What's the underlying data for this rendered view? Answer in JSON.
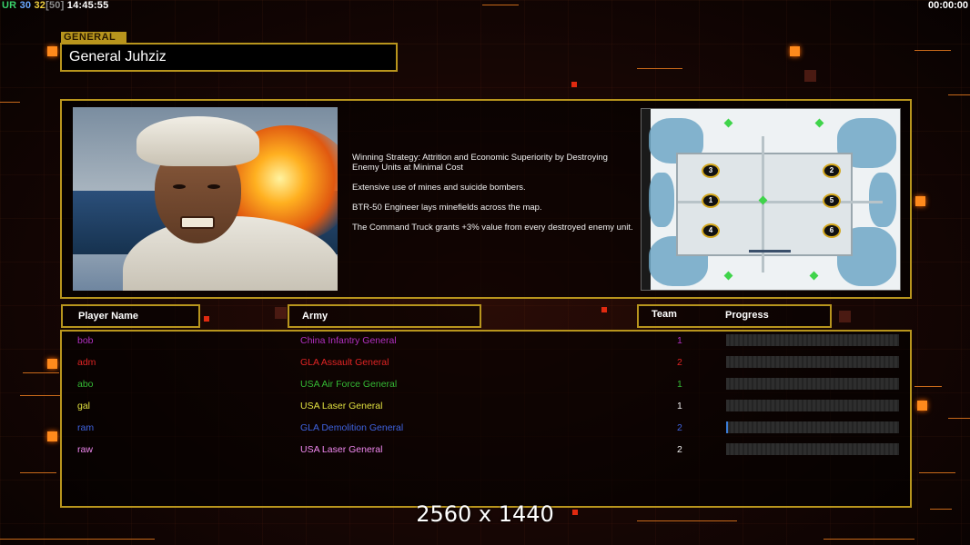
{
  "hud": {
    "left_prefix": "UR",
    "left_a": "30",
    "left_b": "32",
    "left_c": "[50]",
    "left_time": "14:45:55",
    "right_time": "00:00:00"
  },
  "general": {
    "tag": "GENERAL",
    "name": "General Juhziz",
    "description": [
      "Winning Strategy: Attrition and Economic Superiority by Destroying Enemy Units at Minimal Cost",
      "Extensive use of mines and suicide bombers.",
      "BTR-50 Engineer lays minefields across the map.",
      "The Command Truck grants +3% value from every destroyed enemy unit."
    ]
  },
  "map": {
    "spots": [
      "1",
      "2",
      "3",
      "4",
      "5",
      "6"
    ]
  },
  "table": {
    "headers": {
      "player": "Player Name",
      "army": "Army",
      "team": "Team",
      "progress": "Progress"
    },
    "rows": [
      {
        "name": "bob",
        "army": "China Infantry General",
        "team": "1",
        "color": "#b030c0",
        "progress": 0
      },
      {
        "name": "adm",
        "army": "GLA Assault General",
        "team": "2",
        "color": "#e02424",
        "progress": 0
      },
      {
        "name": "abo",
        "army": "USA Air Force General",
        "team": "1",
        "color": "#34b834",
        "progress": 0
      },
      {
        "name": "gal",
        "army": "USA Laser General",
        "team": "1",
        "color": "#e0e040",
        "progress": 0
      },
      {
        "name": "ram",
        "army": "GLA Demolition General",
        "team": "2",
        "color": "#3f63e0",
        "progress": 0.01
      },
      {
        "name": "raw",
        "army": "USA Laser General",
        "team": "2",
        "color": "#f088f0",
        "progress": 0
      }
    ]
  },
  "resolution": "2560 x 1440",
  "colors": {
    "accent_gold": "#b8951d",
    "accent_orange": "#ff8a1c"
  }
}
